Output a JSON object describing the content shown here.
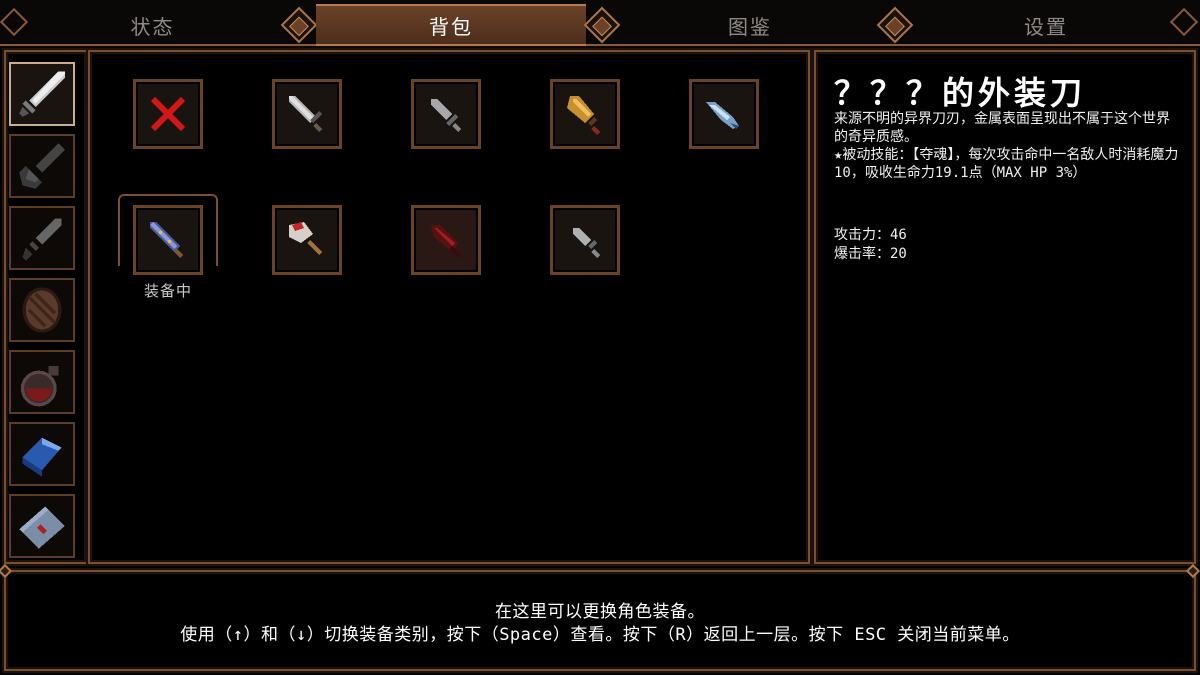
{
  "tabs": [
    {
      "label": "状态",
      "active": false
    },
    {
      "label": "背包",
      "active": true
    },
    {
      "label": "图鉴",
      "active": false
    },
    {
      "label": "设置",
      "active": false
    }
  ],
  "categories": [
    {
      "icon": "sword-icon",
      "active": true
    },
    {
      "icon": "shovel-icon",
      "active": false
    },
    {
      "icon": "dagger-icon",
      "active": false
    },
    {
      "icon": "shield-icon",
      "active": false
    },
    {
      "icon": "potion-icon",
      "active": false
    },
    {
      "icon": "crystal-icon",
      "active": false
    },
    {
      "icon": "letter-icon",
      "active": false
    }
  ],
  "inventory": [
    {
      "icon": "unequip-x-icon"
    },
    {
      "icon": "steel-sword-icon"
    },
    {
      "icon": "short-sword-icon"
    },
    {
      "icon": "golden-dagger-icon"
    },
    {
      "icon": "blue-blade-icon"
    },
    {
      "icon": "jeweled-sword-icon",
      "equipped": true
    },
    {
      "icon": "red-cleaver-icon"
    },
    {
      "icon": "blood-blade-icon"
    },
    {
      "icon": "small-dagger-icon"
    }
  ],
  "equipped_label": "装备中",
  "detail": {
    "title": "？？？的外装刀",
    "description": "来源不明的异界刀刃，金属表面呈现出不属于这个世界的奇异质感。",
    "passive": "★被动技能：【夺魂】，每次攻击命中一名敌人时消耗魔力10，吸收生命力19.1点（MAX HP 3%）",
    "stats": [
      {
        "label": "攻击力：46"
      },
      {
        "label": "爆击率：20"
      }
    ]
  },
  "hints": {
    "line1": "在这里可以更换角色装备。",
    "line2": "使用（↑）和（↓）切换装备类别，按下（Space）查看。按下（R）返回上一层。按下 ESC 关闭当前菜单。"
  }
}
